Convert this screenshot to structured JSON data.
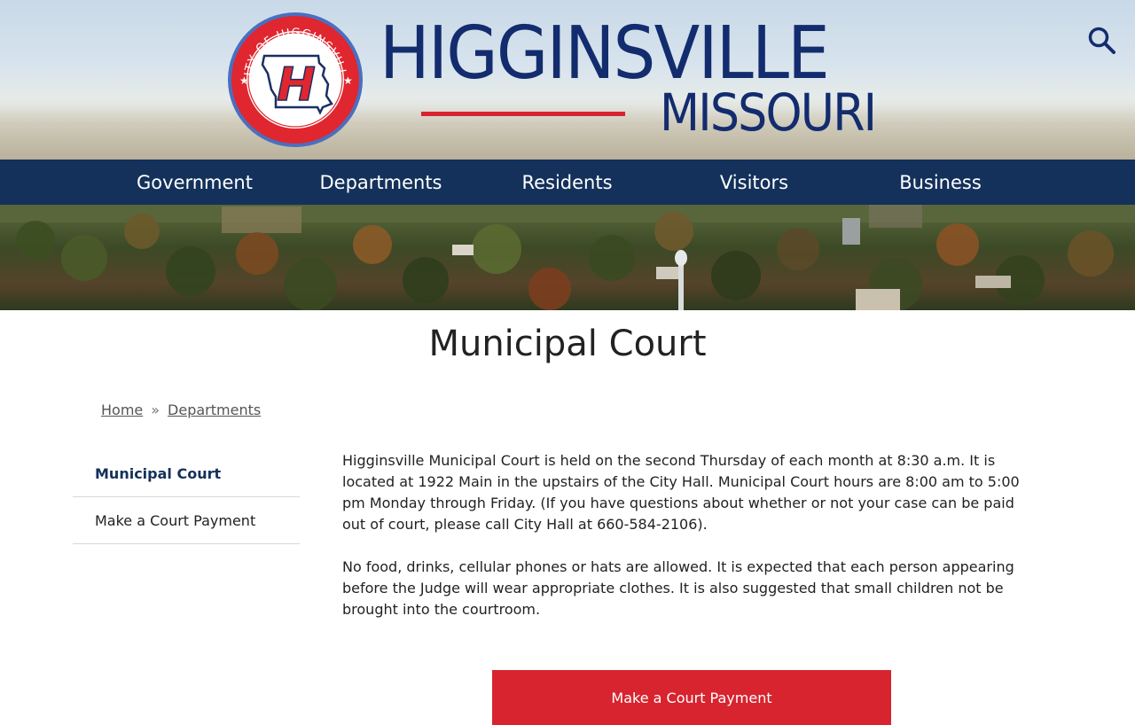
{
  "header": {
    "city_name": "HIGGINSVILLE",
    "state_name": "MISSOURI",
    "seal_text_top": "CITY OF HIGGINSVILLE",
    "seal_letter": "H",
    "search_icon": "search-icon"
  },
  "nav": {
    "items": [
      {
        "label": "Government"
      },
      {
        "label": "Departments"
      },
      {
        "label": "Residents"
      },
      {
        "label": "Visitors"
      },
      {
        "label": "Business"
      }
    ]
  },
  "page": {
    "title": "Municipal Court"
  },
  "breadcrumb": {
    "home": "Home",
    "separator": "»",
    "departments": "Departments"
  },
  "sidebar": {
    "items": [
      {
        "label": "Municipal Court"
      },
      {
        "label": "Make a Court Payment"
      }
    ]
  },
  "content": {
    "paragraph_1": "Higginsville Municipal Court is held on the second Thursday of each month at 8:30 a.m.  It is located at 1922 Main in the upstairs of the City Hall. Municipal Court hours are 8:00 am to 5:00 pm Monday through Friday.   (If you have questions about whether or not your case can be paid out of court, please call City Hall at 660-584-2106).",
    "paragraph_2": "No food, drinks, cellular phones or hats are allowed.  It is expected that each person appearing before the Judge will wear appropriate clothes.   It is also suggested that small children not be brought into the courtroom.",
    "cta_label": "Make a Court Payment"
  },
  "colors": {
    "brand_navy": "#132c6e",
    "nav_bg": "#13315a",
    "accent_red": "#d7242f"
  }
}
